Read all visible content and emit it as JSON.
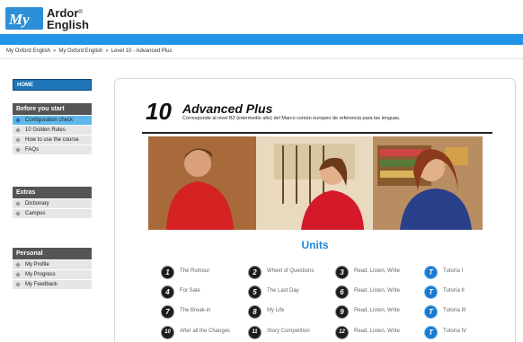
{
  "brand": {
    "line1": "Ardor",
    "line2": "English",
    "mark": "®",
    "logo_text": "My"
  },
  "breadcrumb": [
    "My Oxford English",
    "My Oxford English",
    "Level 10 - Advanced Plus"
  ],
  "breadcrumb_separator": "»",
  "sidebar": {
    "home": "HOME",
    "sections": [
      {
        "title": "Before you start",
        "items": [
          "Configuration check",
          "10 Golden Rules",
          "How to use the course",
          "FAQs"
        ],
        "active_index": 0
      },
      {
        "title": "Extras",
        "items": [
          "Dictionary",
          "Campus"
        ]
      },
      {
        "title": "Personal",
        "items": [
          "My Profile",
          "My Progress",
          "My Feedback"
        ]
      }
    ]
  },
  "level": {
    "number": "10",
    "title": "Advanced Plus",
    "subtitle": "Corresponde al nivel B2 (intermedio alto) del Marco común europeo de referencia para las lenguas."
  },
  "units_title": "Units",
  "units": [
    {
      "num": "1",
      "label": "The Rumour"
    },
    {
      "num": "2",
      "label": "Wheel of Questions"
    },
    {
      "num": "3",
      "label": "Read, Listen, Write"
    },
    {
      "num": "T",
      "label": "Tutoría I",
      "style": "tutorial"
    },
    {
      "num": "4",
      "label": "For Sale"
    },
    {
      "num": "5",
      "label": "The Last Day"
    },
    {
      "num": "6",
      "label": "Read, Listen, Write"
    },
    {
      "num": "T",
      "label": "Tutoría II",
      "style": "tutorial"
    },
    {
      "num": "7",
      "label": "The Break-in"
    },
    {
      "num": "8",
      "label": "My Life"
    },
    {
      "num": "9",
      "label": "Read, Listen, Write"
    },
    {
      "num": "T",
      "label": "Tutoría III",
      "style": "tutorial"
    },
    {
      "num": "10",
      "label": "After all the Changes"
    },
    {
      "num": "11",
      "label": "Story Competition"
    },
    {
      "num": "12",
      "label": "Read, Listen, Write"
    },
    {
      "num": "T",
      "label": "Tutoría IV",
      "style": "tutorial"
    }
  ],
  "colors": {
    "accent_blue": "#2196e8",
    "units_title": "#1e88d8",
    "active_item": "#5fb7ea"
  }
}
